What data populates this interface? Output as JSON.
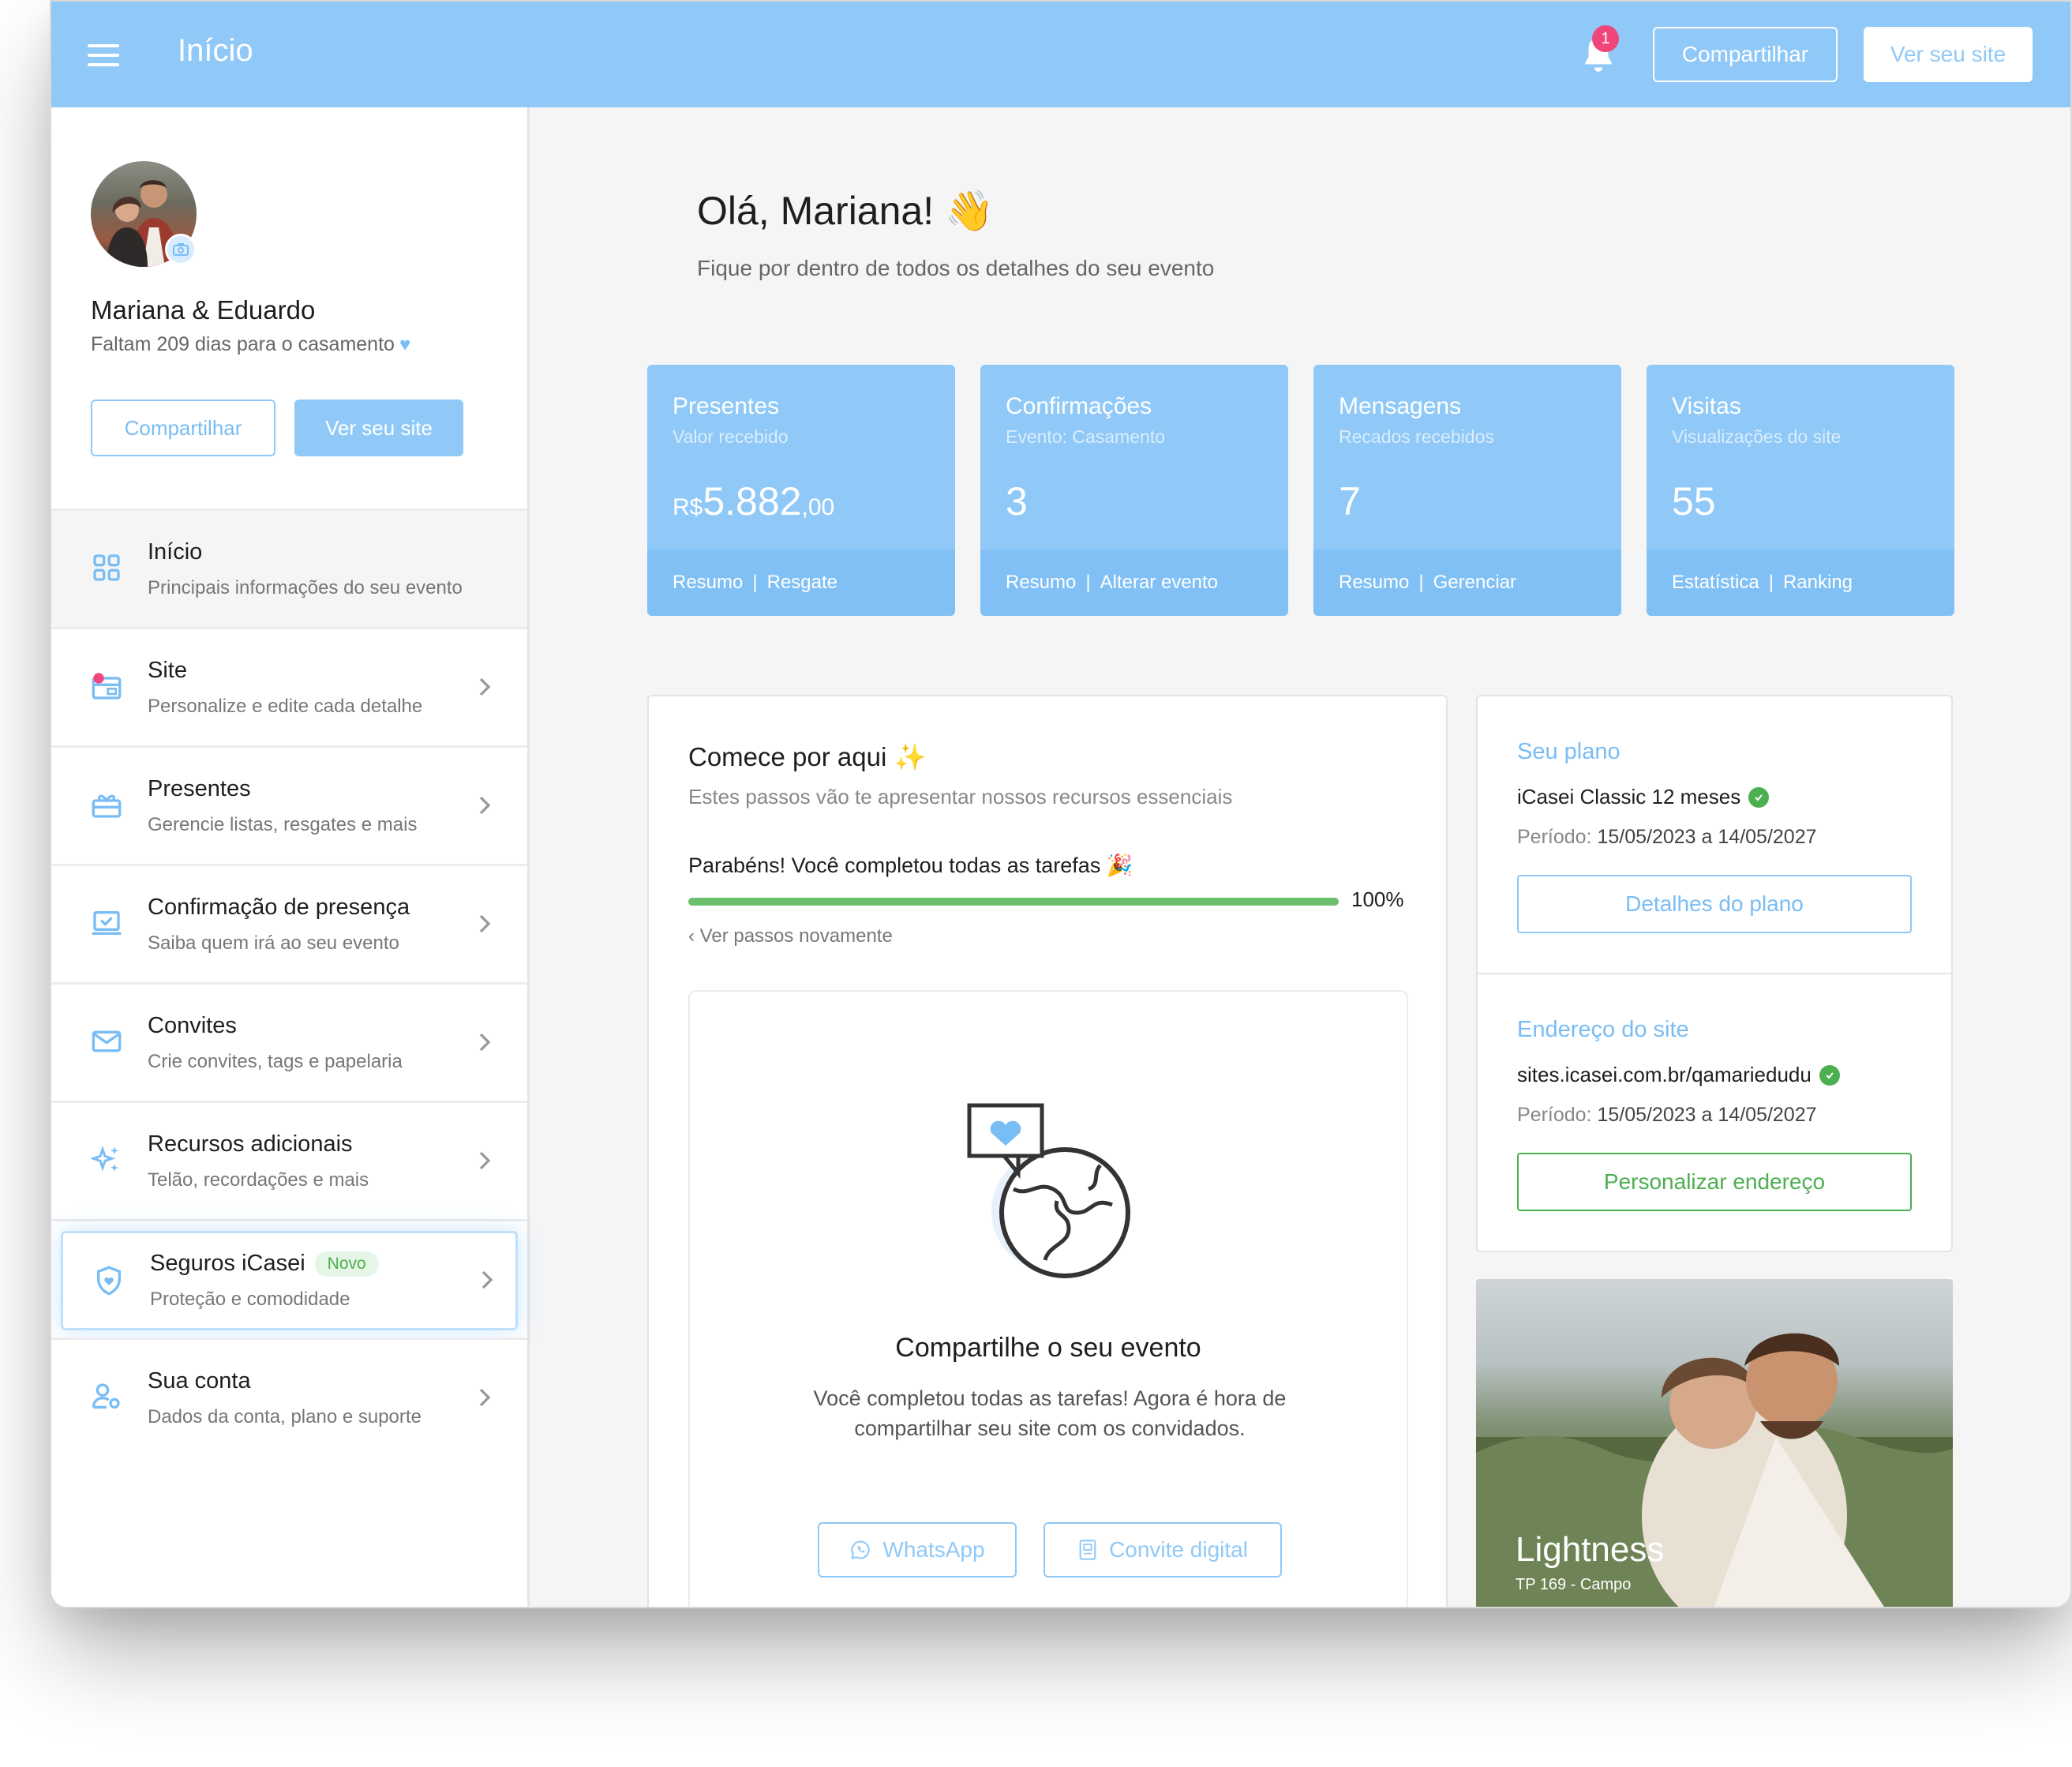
{
  "topbar": {
    "title": "Início",
    "notification_count": "1",
    "share_label": "Compartilhar",
    "site_label": "Ver seu site"
  },
  "profile": {
    "couple_name": "Mariana & Eduardo",
    "countdown": "Faltam 209 dias para o casamento",
    "share_label": "Compartilhar",
    "site_label": "Ver seu site"
  },
  "nav": [
    {
      "title": "Início",
      "subtitle": "Principais informações do seu evento",
      "icon": "grid-icon"
    },
    {
      "title": "Site",
      "subtitle": "Personalize e edite cada detalhe",
      "icon": "site-icon"
    },
    {
      "title": "Presentes",
      "subtitle": "Gerencie listas, resgates e mais",
      "icon": "gift-icon"
    },
    {
      "title": "Confirmação de presença",
      "subtitle": "Saiba quem irá ao seu evento",
      "icon": "laptop-check-icon"
    },
    {
      "title": "Convites",
      "subtitle": "Crie convites, tags e papelaria",
      "icon": "envelope-icon"
    },
    {
      "title": "Recursos adicionais",
      "subtitle": "Telão, recordações e mais",
      "icon": "sparkles-icon"
    },
    {
      "title": "Seguros iCasei",
      "badge": "Novo",
      "subtitle": "Proteção e comodidade",
      "icon": "shield-icon"
    },
    {
      "title": "Sua conta",
      "subtitle": "Dados da conta, plano e suporte",
      "icon": "user-gear-icon"
    }
  ],
  "greeting": {
    "title": "Olá, Mariana!",
    "emoji": "👋",
    "subtitle": "Fique por dentro de todos os detalhes do seu evento"
  },
  "stats": [
    {
      "title": "Presentes",
      "subtitle": "Valor recebido",
      "currency": "R$",
      "value": "5.882",
      "cents": ",00",
      "link1": "Resumo",
      "link2": "Resgate"
    },
    {
      "title": "Confirmações",
      "subtitle": "Evento: Casamento",
      "value": "3",
      "link1": "Resumo",
      "link2": "Alterar evento"
    },
    {
      "title": "Mensagens",
      "subtitle": "Recados recebidos",
      "value": "7",
      "link1": "Resumo",
      "link2": "Gerenciar"
    },
    {
      "title": "Visitas",
      "subtitle": "Visualizações do site",
      "value": "55",
      "link1": "Estatística",
      "link2": "Ranking"
    }
  ],
  "start": {
    "title": "Comece por aqui",
    "subtitle": "Estes passos vão te apresentar nossos recursos essenciais",
    "congrats": "Parabéns! Você completou todas as tarefas",
    "progress": 1.0,
    "progress_label": "100%",
    "replay": "Ver passos novamente",
    "share_title": "Compartilhe o seu evento",
    "share_text": "Você completou todas as tarefas! Agora é hora de compartilhar seu site com os convidados.",
    "whatsapp_label": "WhatsApp",
    "invite_label": "Convite digital"
  },
  "plan": {
    "label": "Seu plano",
    "name": "iCasei Classic 12 meses",
    "period_label": "Período:",
    "period_value": "15/05/2023 a 14/05/2027",
    "button": "Detalhes do plano"
  },
  "address": {
    "label": "Endereço do site",
    "url": "sites.icasei.com.br/qamariedudu",
    "period_label": "Período:",
    "period_value": "15/05/2023 a 14/05/2027",
    "button": "Personalizar endereço"
  },
  "promo": {
    "title": "Lightness",
    "subtitle": "TP 169 - Campo"
  },
  "colors": {
    "accent": "#90c9f7",
    "success": "#4caf50",
    "badge": "#f0467a"
  }
}
